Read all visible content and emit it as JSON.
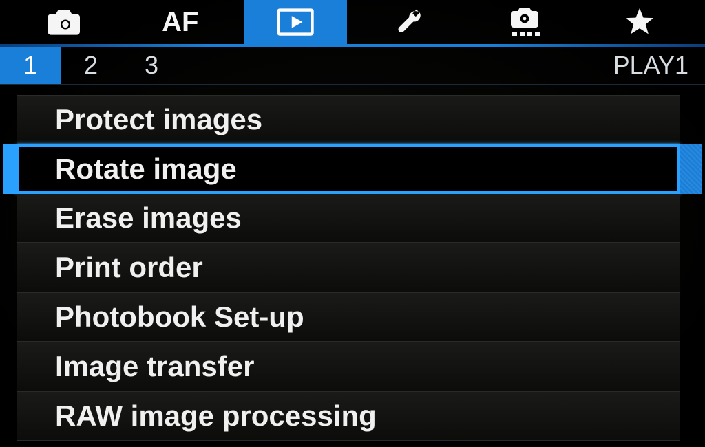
{
  "topTabs": {
    "af_label": "AF"
  },
  "subTabs": {
    "t1": "1",
    "t2": "2",
    "t3": "3",
    "label": "PLAY1"
  },
  "menu": {
    "items": [
      "Protect images",
      "Rotate image",
      "Erase images",
      "Print order",
      "Photobook Set-up",
      "Image transfer",
      "RAW image processing"
    ],
    "selectedIndex": 1
  }
}
